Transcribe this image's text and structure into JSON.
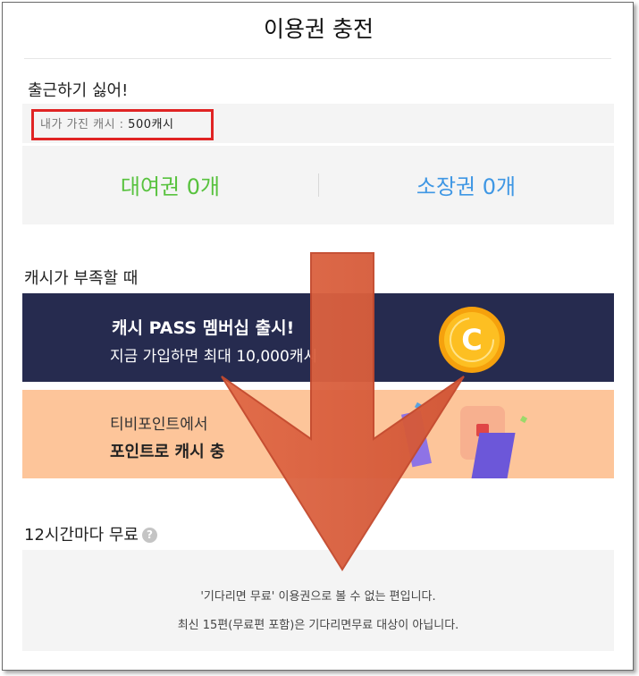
{
  "page": {
    "title": "이용권 충전"
  },
  "series": {
    "title": "출근하기 싫어!"
  },
  "cash": {
    "label": "내가 가진 캐시 : ",
    "amount": "500캐시"
  },
  "tickets": {
    "rental": "대여권 0개",
    "owned": "소장권 0개"
  },
  "shortage": {
    "label": "캐시가 부족할 때",
    "pass_banner": {
      "title": "캐시 PASS 멤버십 출시!",
      "subtitle": "지금 가입하면 최대 10,000캐시",
      "icon": "coin-c-icon"
    },
    "point_banner": {
      "line1": "티비포인트에서",
      "line2": "포인트로 캐시 충"
    }
  },
  "free": {
    "label": "12시간마다 무료",
    "help_icon": "?",
    "notice1": "'기다리면 무료' 이용권으로 볼 수 없는 편입니다.",
    "notice2": "최신 15편(무료편 포함)은 기다리면무료 대상이 아닙니다."
  },
  "colors": {
    "rental": "#58c23e",
    "owned": "#3f97e4",
    "pass_banner_bg": "#262b4f",
    "point_banner_bg": "#fdc59a",
    "highlight_border": "#e02424",
    "arrow": "#d9603f"
  },
  "annotation": {
    "icon": "down-arrow-icon"
  }
}
